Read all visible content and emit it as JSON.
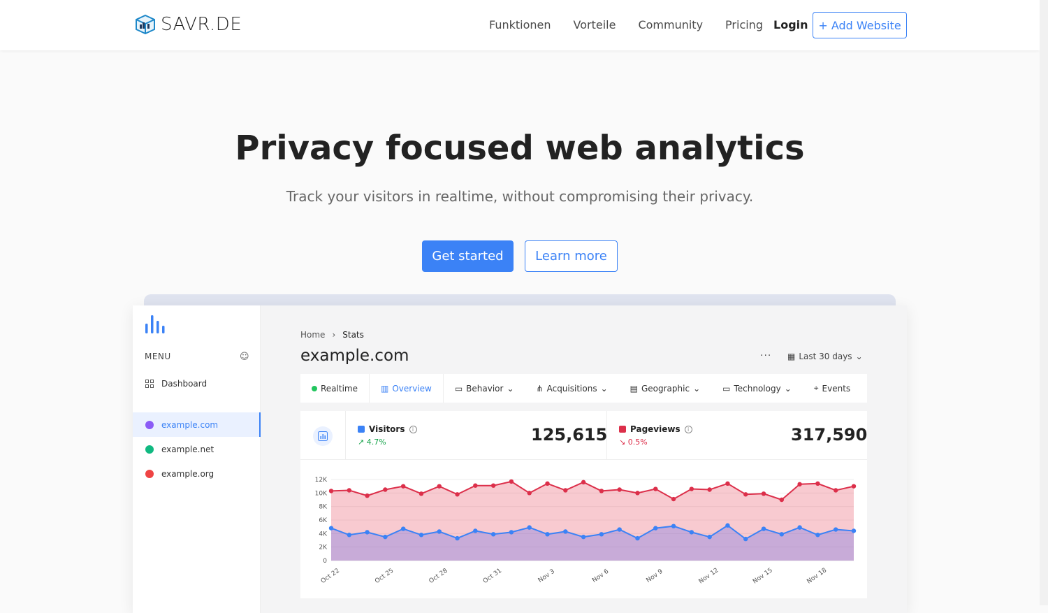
{
  "brand": {
    "name": "SAVR.DE"
  },
  "nav": {
    "items": [
      "Funktionen",
      "Vorteile",
      "Community",
      "Pricing"
    ],
    "login": "Login",
    "add_website": "+ Add Website"
  },
  "hero": {
    "title": "Privacy focused web analytics",
    "subtitle": "Track your visitors in realtime, without compromising their privacy.",
    "primary_cta": "Get started",
    "secondary_cta": "Learn more"
  },
  "dashboard": {
    "menu_label": "MENU",
    "sidebar": [
      {
        "label": "Dashboard",
        "icon": "grid-icon"
      },
      {
        "label": "example.com",
        "icon": "site-icon",
        "color": "#8b5cf6"
      },
      {
        "label": "example.net",
        "icon": "site-icon",
        "color": "#10b981"
      },
      {
        "label": "example.org",
        "icon": "site-icon",
        "color": "#ef4444"
      }
    ],
    "breadcrumb": {
      "home": "Home",
      "current": "Stats"
    },
    "site_title": "example.com",
    "more": "···",
    "date_range": "Last 30 days",
    "tabs": [
      "Realtime",
      "Overview",
      "Behavior",
      "Acquisitions",
      "Geographic",
      "Technology",
      "Events"
    ],
    "visitors": {
      "label": "Visitors",
      "change": "4.7%",
      "value": "125,615",
      "color": "#3b82f6"
    },
    "pageviews": {
      "label": "Pageviews",
      "change": "0.5%",
      "value": "317,590",
      "color": "#dc2f4a"
    }
  },
  "chart_data": {
    "type": "area",
    "x_ticks": [
      "Oct 22",
      "Oct 25",
      "Oct 28",
      "Oct 31",
      "Nov 3",
      "Nov 6",
      "Nov 9",
      "Nov 12",
      "Nov 15",
      "Nov 18"
    ],
    "y_ticks": [
      "0",
      "2K",
      "4K",
      "6K",
      "8K",
      "10K",
      "12K"
    ],
    "ylim": [
      0,
      12000
    ],
    "series": [
      {
        "name": "Pageviews",
        "color": "#dc2f4a",
        "values": [
          10300,
          10400,
          9600,
          10500,
          11000,
          9900,
          11000,
          9800,
          11100,
          11100,
          11700,
          10000,
          11400,
          10400,
          11600,
          10300,
          10500,
          10000,
          10600,
          9100,
          10600,
          10500,
          11400,
          9800,
          9900,
          9000,
          11300,
          11400,
          10400,
          11000
        ]
      },
      {
        "name": "Visitors",
        "color": "#3b82f6",
        "values": [
          4800,
          3800,
          4200,
          3500,
          4700,
          3800,
          4300,
          3300,
          4400,
          3900,
          4200,
          4900,
          3900,
          4300,
          3500,
          3900,
          4600,
          3300,
          4800,
          5100,
          4200,
          3500,
          5200,
          3200,
          4700,
          3900,
          4900,
          3800,
          4600,
          4400
        ]
      }
    ]
  }
}
